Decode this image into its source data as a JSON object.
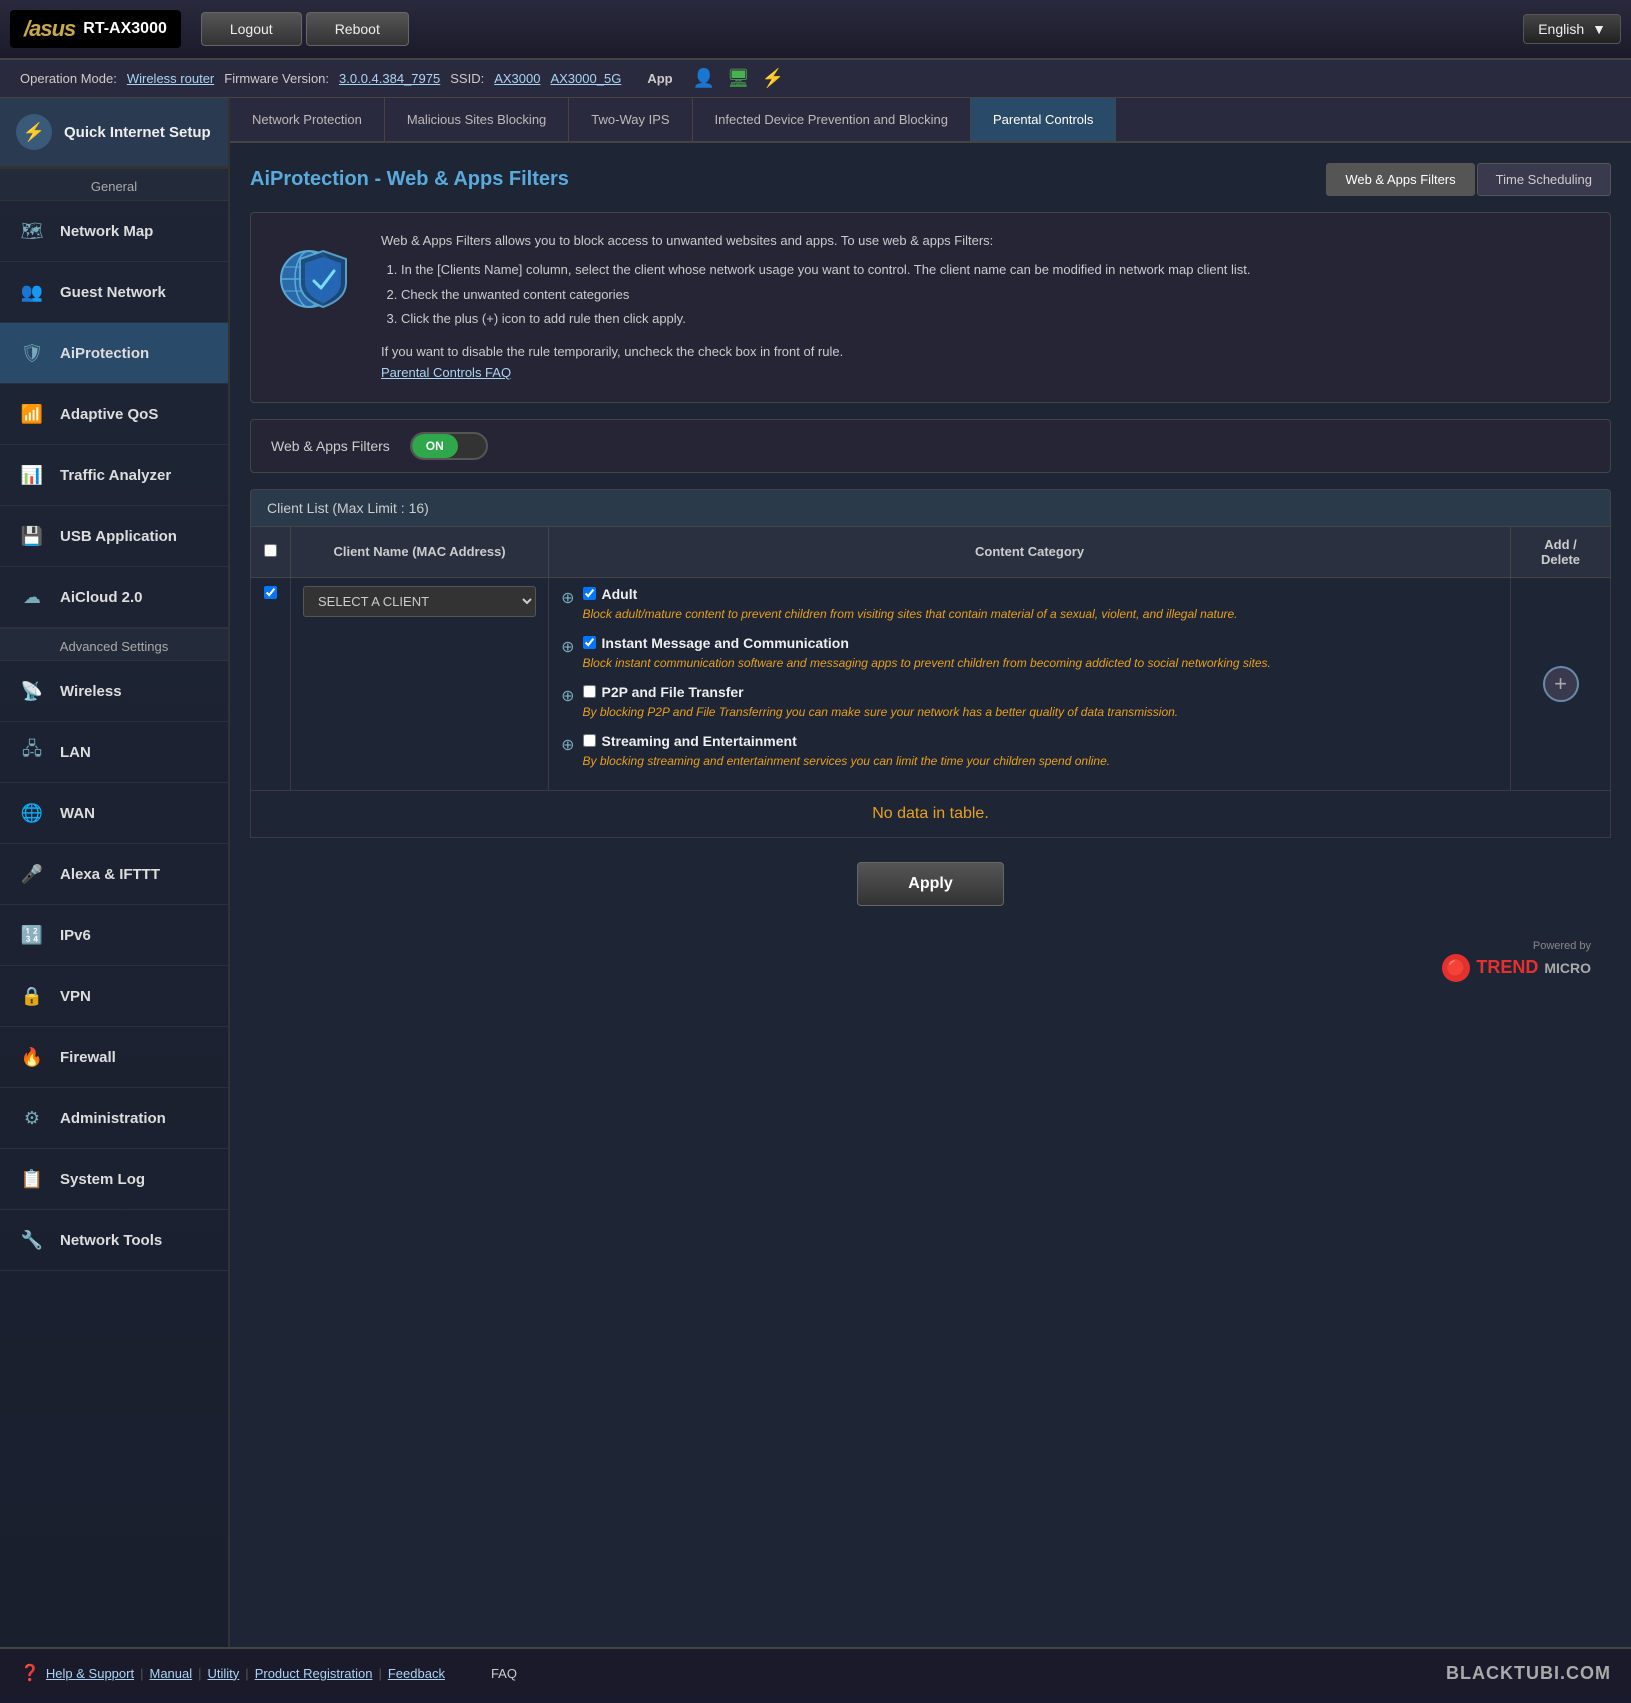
{
  "topbar": {
    "logo_brand": "/asus",
    "logo_model": "RT-AX3000",
    "logout_label": "Logout",
    "reboot_label": "Reboot",
    "language": "English"
  },
  "statusbar": {
    "operation_mode_label": "Operation Mode:",
    "operation_mode_value": "Wireless router",
    "firmware_label": "Firmware Version:",
    "firmware_value": "3.0.0.4.384_7975",
    "ssid_label": "SSID:",
    "ssid_value1": "AX3000",
    "ssid_value2": "AX3000_5G",
    "app_label": "App"
  },
  "sidebar": {
    "quick_setup_label": "Quick Internet Setup",
    "general_label": "General",
    "items": [
      {
        "id": "network-map",
        "label": "Network Map",
        "icon": "🗺"
      },
      {
        "id": "guest-network",
        "label": "Guest Network",
        "icon": "👥"
      },
      {
        "id": "aiprotection",
        "label": "AiProtection",
        "icon": "🛡",
        "active": true
      },
      {
        "id": "adaptive-qos",
        "label": "Adaptive QoS",
        "icon": "📶"
      },
      {
        "id": "traffic-analyzer",
        "label": "Traffic Analyzer",
        "icon": "📊"
      },
      {
        "id": "usb-application",
        "label": "USB Application",
        "icon": "💾"
      },
      {
        "id": "aicloud",
        "label": "AiCloud 2.0",
        "icon": "☁"
      }
    ],
    "advanced_label": "Advanced Settings",
    "advanced_items": [
      {
        "id": "wireless",
        "label": "Wireless",
        "icon": "📡"
      },
      {
        "id": "lan",
        "label": "LAN",
        "icon": "🖧"
      },
      {
        "id": "wan",
        "label": "WAN",
        "icon": "🌐"
      },
      {
        "id": "alexa",
        "label": "Alexa & IFTTT",
        "icon": "🎤"
      },
      {
        "id": "ipv6",
        "label": "IPv6",
        "icon": "🔢"
      },
      {
        "id": "vpn",
        "label": "VPN",
        "icon": "🔒"
      },
      {
        "id": "firewall",
        "label": "Firewall",
        "icon": "🔥"
      },
      {
        "id": "administration",
        "label": "Administration",
        "icon": "⚙"
      },
      {
        "id": "system-log",
        "label": "System Log",
        "icon": "📋"
      },
      {
        "id": "network-tools",
        "label": "Network Tools",
        "icon": "🔧"
      }
    ]
  },
  "tabs": [
    {
      "id": "network-protection",
      "label": "Network Protection",
      "active": false
    },
    {
      "id": "malicious-sites",
      "label": "Malicious Sites Blocking",
      "active": false
    },
    {
      "id": "two-way-ips",
      "label": "Two-Way IPS",
      "active": false
    },
    {
      "id": "infected-device",
      "label": "Infected Device Prevention and Blocking",
      "active": false
    },
    {
      "id": "parental-controls",
      "label": "Parental Controls",
      "active": true
    }
  ],
  "page": {
    "title": "AiProtection - Web & Apps Filters",
    "subtabs": [
      {
        "label": "Web & Apps Filters",
        "active": true
      },
      {
        "label": "Time Scheduling",
        "active": false
      }
    ],
    "description_intro": "Web & Apps Filters allows you to block access to unwanted websites and apps. To use web & apps Filters:",
    "description_steps": [
      "In the [Clients Name] column, select the client whose network usage you want to control. The client name can be modified in network map client list.",
      "Check the unwanted content categories",
      "Click the plus (+) icon to add rule then click apply."
    ],
    "description_note": "If you want to disable the rule temporarily, uncheck the check box in front of rule.",
    "description_link": "Parental Controls FAQ",
    "toggle_label": "Web & Apps Filters",
    "toggle_on": "ON",
    "toggle_off": "",
    "client_list_header": "Client List (Max Limit : 16)",
    "table_col1": "",
    "table_col2": "Client Name (MAC Address)",
    "table_col3": "Content Category",
    "table_col4": "Add / Delete",
    "client_placeholder": "SELECT A CLIENT",
    "categories": [
      {
        "id": "adult",
        "label": "Adult",
        "checked": true,
        "description": "Block adult/mature content to prevent children from visiting sites that contain material of a sexual, violent, and illegal nature."
      },
      {
        "id": "instant-message",
        "label": "Instant Message and Communication",
        "checked": true,
        "description": "Block instant communication software and messaging apps to prevent children from becoming addicted to social networking sites."
      },
      {
        "id": "p2p",
        "label": "P2P and File Transfer",
        "checked": false,
        "description": "By blocking P2P and File Transferring you can make sure your network has a better quality of data transmission."
      },
      {
        "id": "streaming",
        "label": "Streaming and Entertainment",
        "checked": false,
        "description": "By blocking streaming and entertainment services you can limit the time your children spend online."
      }
    ],
    "no_data_label": "No data in table.",
    "apply_label": "Apply",
    "powered_by": "Powered by",
    "trend_logo": "TREND",
    "trend_sub": "MICRO"
  },
  "footer": {
    "help_label": "Help & Support",
    "manual_label": "Manual",
    "utility_label": "Utility",
    "product_reg_label": "Product Registration",
    "feedback_label": "Feedback",
    "faq_label": "FAQ",
    "watermark": "BLACKTUBI.COM"
  }
}
